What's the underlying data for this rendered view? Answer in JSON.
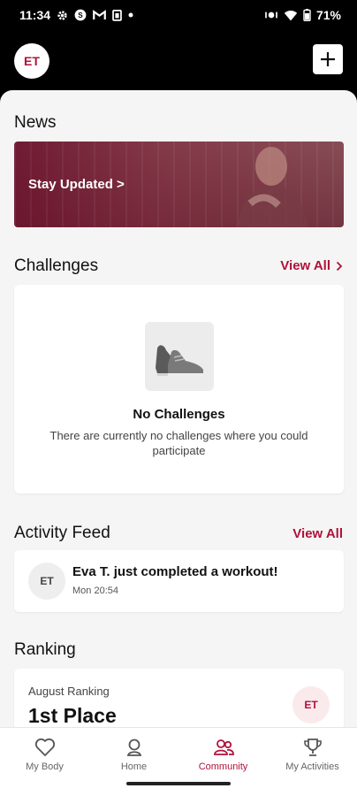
{
  "status_bar": {
    "time": "11:34",
    "battery": "71%"
  },
  "header": {
    "avatar_initials": "ET"
  },
  "news": {
    "title": "News",
    "banner_label": "Stay Updated >"
  },
  "challenges": {
    "title": "Challenges",
    "view_all": "View All",
    "empty_title": "No Challenges",
    "empty_text": "There are currently no challenges where you could participate"
  },
  "activity_feed": {
    "title": "Activity Feed",
    "view_all": "View All",
    "items": [
      {
        "avatar": "ET",
        "text": "Eva T. just completed a workout!",
        "time": "Mon 20:54"
      }
    ]
  },
  "ranking": {
    "title": "Ranking",
    "period": "August Ranking",
    "place": "1st Place",
    "avatar": "ET"
  },
  "nav": {
    "items": [
      {
        "label": "My Body",
        "icon": "heart-icon"
      },
      {
        "label": "Home",
        "icon": "home-pin-icon"
      },
      {
        "label": "Community",
        "icon": "community-icon"
      },
      {
        "label": "My Activities",
        "icon": "trophy-icon"
      }
    ],
    "active": "Community"
  },
  "colors": {
    "accent": "#b0123a",
    "background": "#f5f5f5",
    "header": "#000000"
  }
}
